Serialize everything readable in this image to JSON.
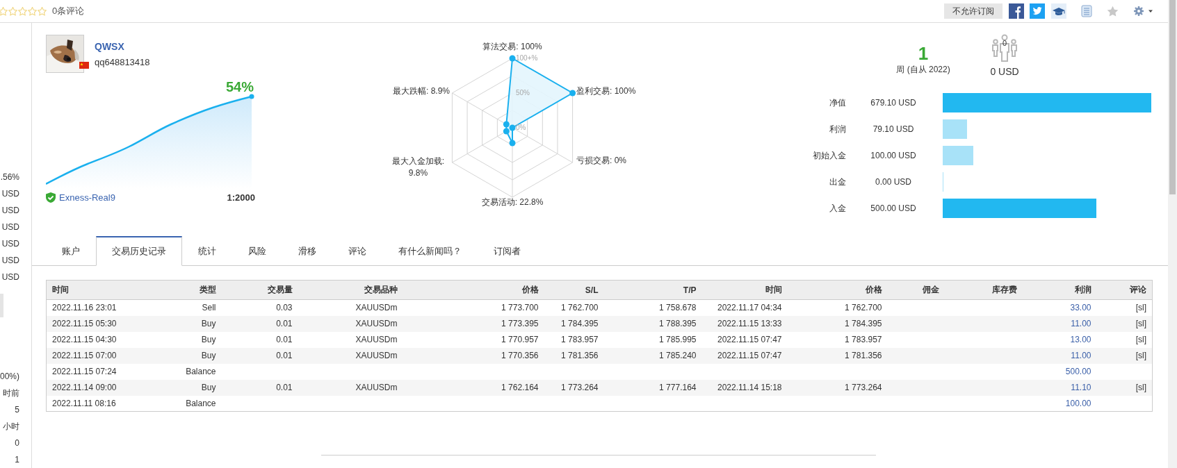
{
  "rating": {
    "stars": 0,
    "reviews": "0条评论"
  },
  "toolbar": {
    "subscribe_button": "不允许订阅"
  },
  "sidebar": {
    "upper": [
      ".56%",
      "USD",
      "USD",
      "USD",
      "USD",
      "USD",
      "USD"
    ],
    "lower": [
      "00%)",
      "时前",
      "5",
      "小时",
      "0",
      "1"
    ]
  },
  "profile": {
    "name": "QWSX",
    "login": "qq648813418",
    "growth": "54%",
    "server": "Exness-Real9",
    "leverage": "1:2000"
  },
  "radar": {
    "ticks": [
      "100+%",
      "50%",
      "0%"
    ],
    "axes": [
      "算法交易: 100%",
      "最大跌幅: 8.9%",
      "盈利交易: 100%",
      "最大入金加载: 9.8%",
      "亏损交易: 0%",
      "交易活动: 22.8%"
    ]
  },
  "summary": {
    "weeks": "1",
    "weeks_label": "周 (自从 2022)",
    "subscribers": "0",
    "funds": "0 USD"
  },
  "balances": [
    {
      "label": "净值",
      "value": "679.10 USD",
      "level": 1,
      "color": "#22b8f0"
    },
    {
      "label": "利润",
      "value": "79.10 USD",
      "level": 0.116,
      "color": "#a8e2f8"
    },
    {
      "label": "初始入金",
      "value": "100.00 USD",
      "level": 0.148,
      "color": "#a8e2f8"
    },
    {
      "label": "出金",
      "value": "0.00 USD",
      "level": 0.004,
      "color": "#a8e2f8"
    },
    {
      "label": "入金",
      "value": "500.00 USD",
      "level": 0.736,
      "color": "#22b8f0"
    }
  ],
  "tabs": [
    {
      "label": "账户",
      "selected": false
    },
    {
      "label": "交易历史记录",
      "selected": true
    },
    {
      "label": "统计",
      "selected": false
    },
    {
      "label": "风险",
      "selected": false
    },
    {
      "label": "滑移",
      "selected": false
    },
    {
      "label": "评论",
      "selected": false
    },
    {
      "label": "有什么新闻吗？",
      "selected": false
    },
    {
      "label": "订阅者",
      "selected": false
    }
  ],
  "trades": {
    "columns": [
      "时间",
      "类型",
      "交易量",
      "交易品种",
      "价格",
      "S/L",
      "T/P",
      "时间",
      "价格",
      "佣金",
      "库存费",
      "利润",
      "评论"
    ],
    "rows": [
      {
        "open_time": "2022.11.16 23:01",
        "type": "Sell",
        "volume": "0.03",
        "symbol": "XAUUSDm",
        "open_price": "1 773.700",
        "sl": "1 762.700",
        "tp": "1 758.678",
        "close_time": "2022.11.17 04:34",
        "close_price": "1 762.700",
        "profit": "33.00",
        "comment": "[sl]"
      },
      {
        "open_time": "2022.11.15 05:30",
        "type": "Buy",
        "volume": "0.01",
        "symbol": "XAUUSDm",
        "open_price": "1 773.395",
        "sl": "1 784.395",
        "tp": "1 788.395",
        "close_time": "2022.11.15 13:33",
        "close_price": "1 784.395",
        "profit": "11.00",
        "comment": "[sl]"
      },
      {
        "open_time": "2022.11.15 04:30",
        "type": "Buy",
        "volume": "0.01",
        "symbol": "XAUUSDm",
        "open_price": "1 770.957",
        "sl": "1 783.957",
        "tp": "1 785.995",
        "close_time": "2022.11.15 07:47",
        "close_price": "1 783.957",
        "profit": "13.00",
        "comment": "[sl]"
      },
      {
        "open_time": "2022.11.15 07:00",
        "type": "Buy",
        "volume": "0.01",
        "symbol": "XAUUSDm",
        "open_price": "1 770.356",
        "sl": "1 781.356",
        "tp": "1 785.240",
        "close_time": "2022.11.15 07:47",
        "close_price": "1 781.356",
        "profit": "11.00",
        "comment": "[sl]"
      },
      {
        "open_time": "2022.11.15 07:24",
        "type": "Balance",
        "profit": "500.00"
      },
      {
        "open_time": "2022.11.14 09:00",
        "type": "Buy",
        "volume": "0.01",
        "symbol": "XAUUSDm",
        "open_price": "1 762.164",
        "sl": "1 773.264",
        "tp": "1 777.164",
        "close_time": "2022.11.14 15:18",
        "close_price": "1 773.264",
        "profit": "11.10",
        "comment": "[sl]"
      },
      {
        "open_time": "2022.11.11 08:16",
        "type": "Balance",
        "profit": "100.00"
      }
    ]
  }
}
